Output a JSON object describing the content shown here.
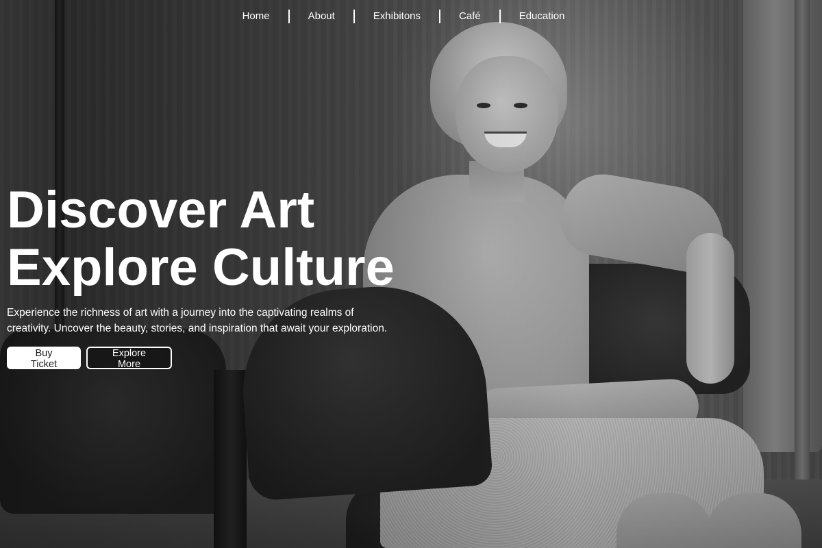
{
  "nav": {
    "items": [
      {
        "label": "Home"
      },
      {
        "label": "About"
      },
      {
        "label": "Exhibitons"
      },
      {
        "label": "Café"
      },
      {
        "label": "Education"
      }
    ]
  },
  "hero": {
    "title_line1": "Discover Art",
    "title_line2": "Explore Culture",
    "description_line1": "Experience the richness of art with a journey into the captivating realms of",
    "description_line2": "creativity. Uncover the beauty, stories, and inspiration that await your exploration.",
    "buttons": {
      "primary": "Buy Ticket",
      "secondary": "Explore More"
    }
  },
  "colors": {
    "text": "#ffffff",
    "primary_button_bg": "#ffffff",
    "primary_button_text": "#1a1a1a",
    "secondary_button_border": "#ffffff"
  }
}
